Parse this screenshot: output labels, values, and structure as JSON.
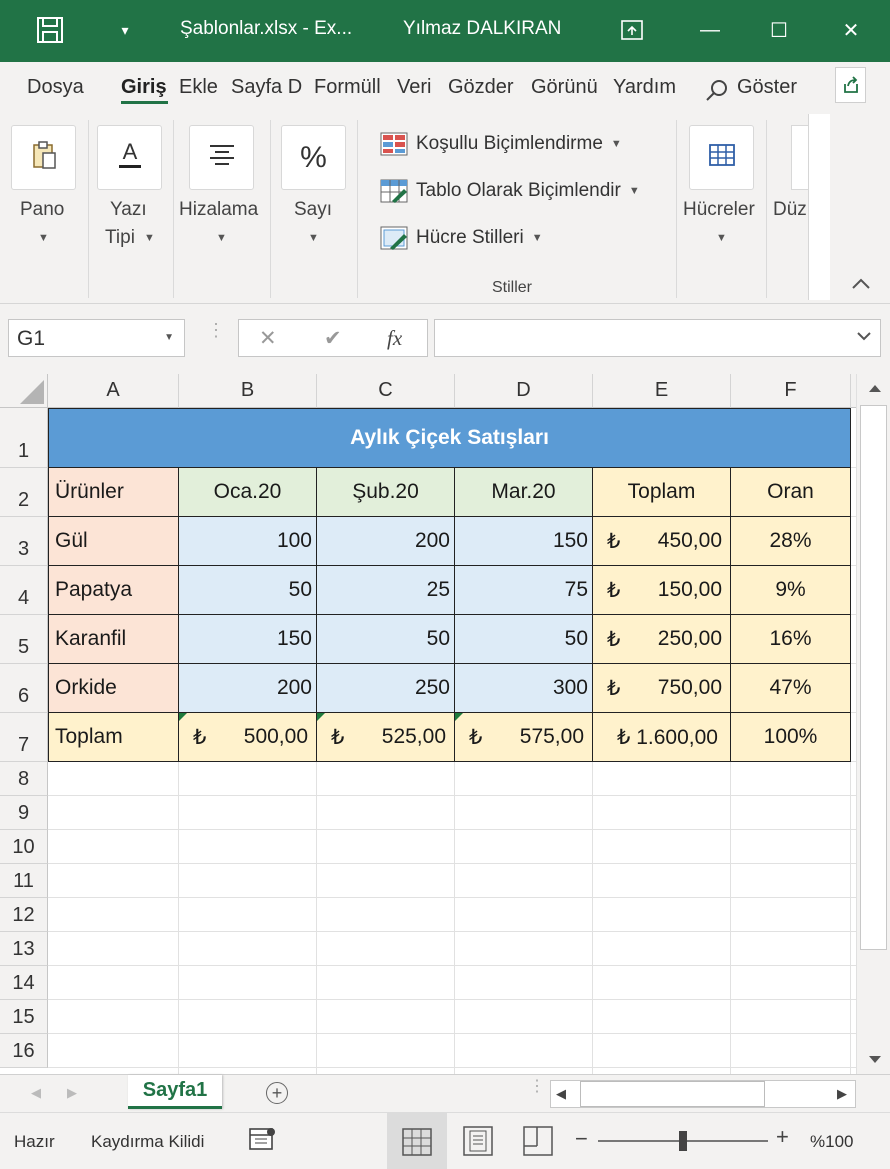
{
  "titlebar": {
    "filename": "Şablonlar.xlsx  -  Ex...",
    "user": "Yılmaz DALKIRAN",
    "quick_access_caret": "▾",
    "minimize": "—",
    "maximize": "☐",
    "close": "✕"
  },
  "tabs": [
    "Dosya",
    "Giriş",
    "Ekle",
    "Sayfa D",
    "Formüll",
    "Veri",
    "Gözder",
    "Görünü",
    "Yardım"
  ],
  "tellme": "Göster",
  "ribbon": {
    "pano": "Pano",
    "yazi_line1": "Yazı",
    "yazi_line2": "Tipi",
    "hizalama": "Hizalama",
    "sayi": "Sayı",
    "sayi_icon": "%",
    "kosullu": "Koşullu Biçimlendirme",
    "tablo": "Tablo Olarak Biçimlendir",
    "hucre_stilleri": "Hücre Stilleri",
    "stiller": "Stiller",
    "hucreler": "Hücreler",
    "duz": "Düz"
  },
  "formula_bar": {
    "namebox": "G1",
    "fx": "fx",
    "cancel": "✕",
    "enter": "✔",
    "value": ""
  },
  "columns": [
    "A",
    "B",
    "C",
    "D",
    "E",
    "F"
  ],
  "rows": [
    "1",
    "2",
    "3",
    "4",
    "5",
    "6",
    "7",
    "8",
    "9",
    "10",
    "11",
    "12",
    "13",
    "14",
    "15",
    "16"
  ],
  "sheet": {
    "title": "Aylık Çiçek Satışları",
    "headers": [
      "Ürünler",
      "Oca.20",
      "Şub.20",
      "Mar.20",
      "Toplam",
      "Oran"
    ],
    "currency_symbol": "₺",
    "rows": [
      {
        "urun": "Gül",
        "oca": "100",
        "sub": "200",
        "mar": "150",
        "toplam": "450,00",
        "oran": "28%"
      },
      {
        "urun": "Papatya",
        "oca": "50",
        "sub": "25",
        "mar": "75",
        "toplam": "150,00",
        "oran": "9%"
      },
      {
        "urun": "Karanfil",
        "oca": "150",
        "sub": "50",
        "mar": "50",
        "toplam": "250,00",
        "oran": "16%"
      },
      {
        "urun": "Orkide",
        "oca": "200",
        "sub": "250",
        "mar": "300",
        "toplam": "750,00",
        "oran": "47%"
      }
    ],
    "total_row": {
      "label": "Toplam",
      "oca": "500,00",
      "sub": "525,00",
      "mar": "575,00",
      "toplam": "₺ 1.600,00",
      "oran": "100%"
    }
  },
  "sheet_tab": "Sayfa1",
  "status": {
    "ready": "Hazır",
    "scroll_lock": "Kaydırma Kilidi",
    "zoom": "%100",
    "zoom_level_percent": 100
  },
  "colors": {
    "excel_green": "#217346",
    "title_fill": "#5b9bd5",
    "header_green": "#e2efda",
    "product_peach": "#fce4d6",
    "month_blue": "#ddebf7",
    "total_yellow": "#fff2cc"
  }
}
